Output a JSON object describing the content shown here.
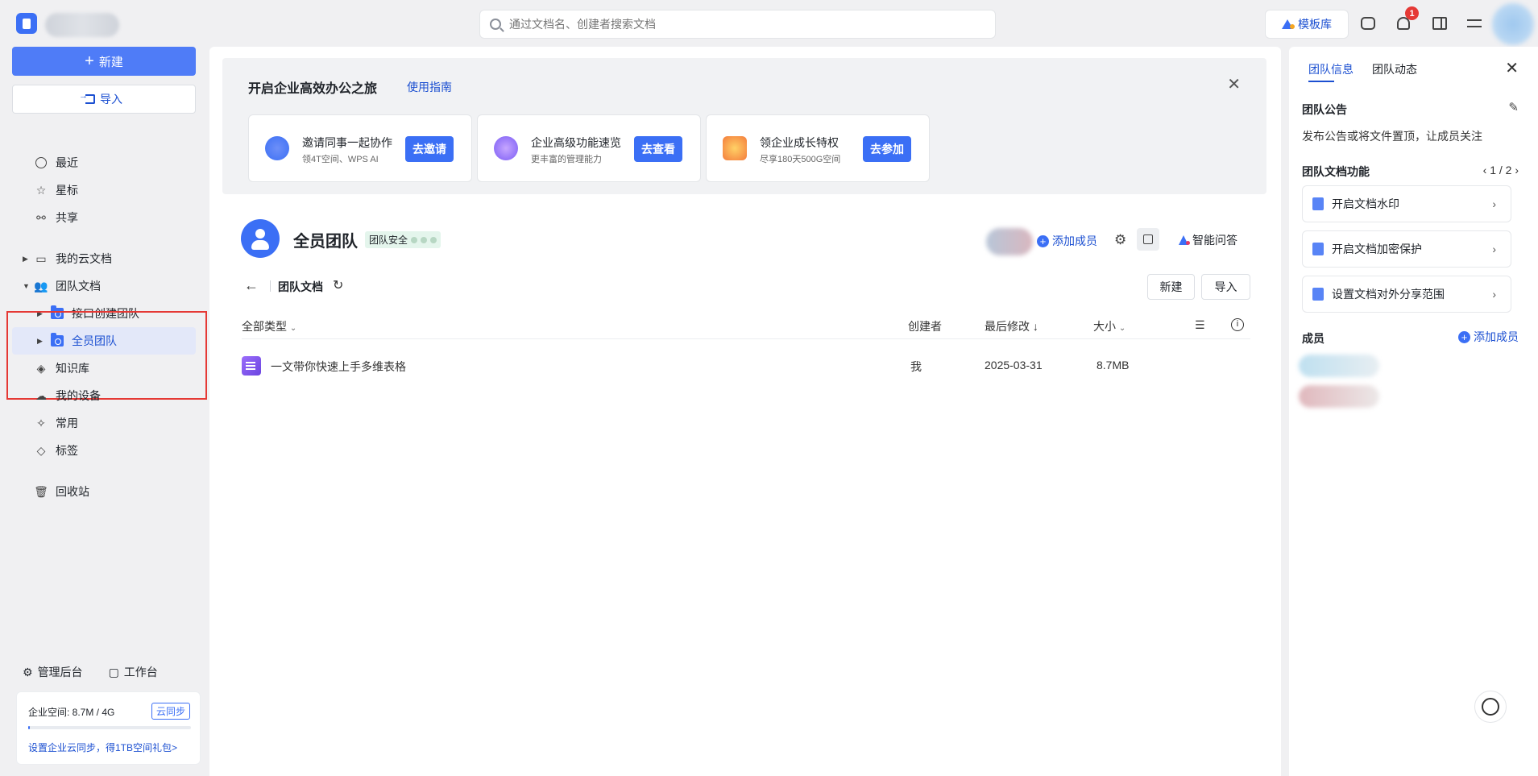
{
  "topbar": {
    "search_placeholder": "通过文档名、创建者搜索文档",
    "template_label": "模板库",
    "notification_count": "1"
  },
  "sidebar": {
    "new_label": "新建",
    "import_label": "导入",
    "items": [
      {
        "label": "最近",
        "icon": "clock-icon"
      },
      {
        "label": "星标",
        "icon": "star-icon"
      },
      {
        "label": "共享",
        "icon": "share-icon"
      },
      {
        "label": "我的云文档",
        "icon": "folder-icon"
      },
      {
        "label": "团队文档",
        "icon": "team-icon"
      },
      {
        "label": "接口创建团队",
        "icon": "team-folder-icon"
      },
      {
        "label": "全员团队",
        "icon": "team-folder-icon"
      },
      {
        "label": "知识库",
        "icon": "knowledge-icon"
      },
      {
        "label": "我的设备",
        "icon": "cloud-device-icon"
      },
      {
        "label": "常用",
        "icon": "pin-icon"
      },
      {
        "label": "标签",
        "icon": "tag-icon"
      },
      {
        "label": "回收站",
        "icon": "trash-icon"
      }
    ],
    "admin_label": "管理后台",
    "workbench_label": "工作台",
    "storage": {
      "label": "企业空间: 8.7M / 4G",
      "sync_badge": "云同步",
      "usage_fraction": 0.002,
      "link": "设置企业云同步，得1TB空间礼包>"
    }
  },
  "main": {
    "promo": {
      "title": "开启企业高效办公之旅",
      "guide_link": "使用指南",
      "cards": [
        {
          "title": "邀请同事一起协作",
          "subtitle": "领4T空间、WPS AI",
          "button": "去邀请"
        },
        {
          "title": "企业高级功能速览",
          "subtitle": "更丰富的管理能力",
          "button": "去查看"
        },
        {
          "title": "领企业成长特权",
          "subtitle": "尽享180天500G空间",
          "button": "去参加"
        }
      ]
    },
    "team": {
      "name": "全员团队",
      "security_tag": "团队安全",
      "add_member": "添加成员",
      "ai_label": "智能问答"
    },
    "crumb_title": "团队文档",
    "new_label": "新建",
    "import_label": "导入",
    "columns": {
      "type": "全部类型",
      "creator": "创建者",
      "modified": "最后修改",
      "size": "大小"
    },
    "rows": [
      {
        "name": "一文带你快速上手多维表格",
        "creator": "我",
        "modified": "2025-03-31",
        "size": "8.7MB"
      }
    ]
  },
  "right_panel": {
    "tabs": [
      "团队信息",
      "团队动态"
    ],
    "announcement_title": "团队公告",
    "announcement_text": "发布公告或将文件置顶，让成员关注",
    "features_title": "团队文档功能",
    "pager": "1 / 2",
    "features": [
      "开启文档水印",
      "开启文档加密保护",
      "设置文档对外分享范围"
    ],
    "members_title": "成员",
    "add_member": "添加成员"
  }
}
